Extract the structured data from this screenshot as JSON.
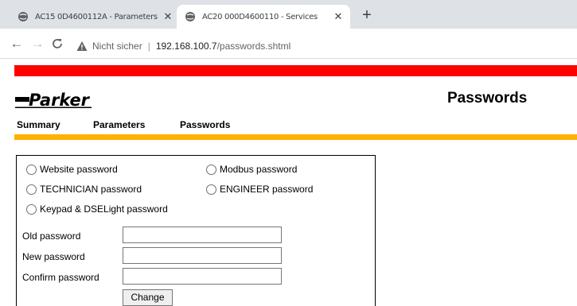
{
  "browser": {
    "tabs": [
      {
        "title": "AC15 0D4600112A - Parameters",
        "active": false
      },
      {
        "title": "AC20 000D4600110 - Services",
        "active": true
      }
    ],
    "new_tab_label": "+",
    "security_label": "Nicht sicher",
    "url_host": "192.168.100.7",
    "url_path": "/passwords.shtml",
    "icons": [
      "back-arrow-icon",
      "forward-arrow-icon",
      "reload-icon",
      "warning-icon",
      "globe-icon",
      "close-icon"
    ]
  },
  "page": {
    "brand_colors": {
      "top_bar": "#ff0000",
      "accent_bar": "#ffb000"
    },
    "logo_text": "Parker",
    "title": "Passwords",
    "nav": {
      "summary": "Summary",
      "parameters": "Parameters",
      "passwords": "Passwords"
    },
    "password_types": {
      "website": "Website password",
      "modbus": "Modbus password",
      "technician": "TECHNICIAN password",
      "engineer": "ENGINEER password",
      "keypad": "Keypad & DSELight password"
    },
    "fields": {
      "old_label": "Old password",
      "new_label": "New password",
      "confirm_label": "Confirm password",
      "old_value": "",
      "new_value": "",
      "confirm_value": ""
    },
    "change_label": "Change"
  }
}
